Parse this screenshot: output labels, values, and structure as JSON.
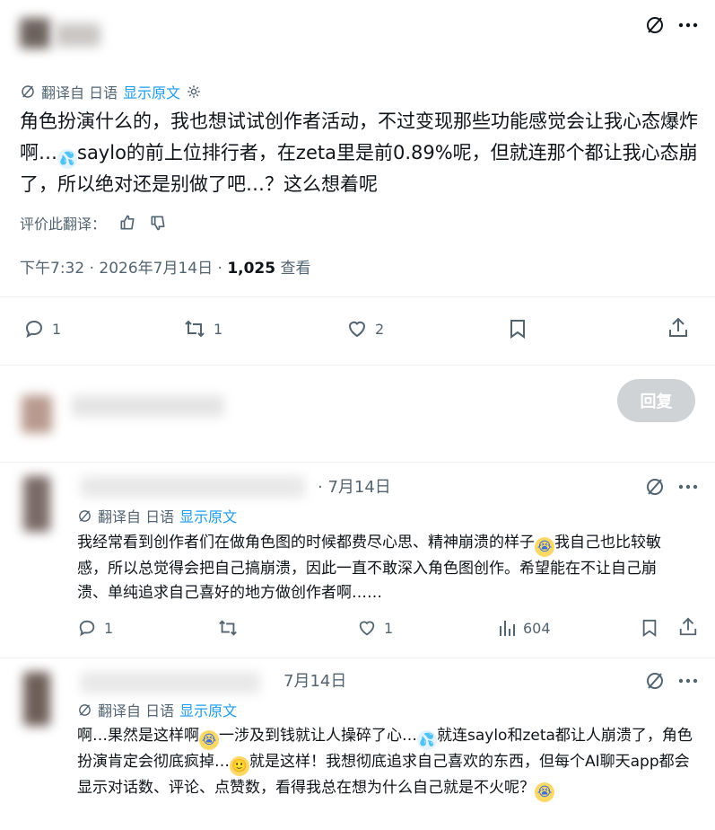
{
  "main_post": {
    "translate_label": "翻译自 日语",
    "show_original": "显示原文",
    "text": "角色扮演什么的，我也想试试创作者活动，不过变现那些功能感觉会让我心态爆炸啊…",
    "text_2": "saylo的前上位排行者，在zeta里是前0.89%呢，但就连那个都让我心态崩了，所以绝对还是别做了吧…？这么想着呢",
    "rate_label": "评价此翻译：",
    "time": "下午7:32 · 2026年7月14日 · ",
    "views_count": "1,025",
    "views_label": " 查看",
    "replies": "1",
    "reposts": "1",
    "likes": "2"
  },
  "reply_box": {
    "button_label": "回复"
  },
  "replies": [
    {
      "date": "· 7月14日",
      "translate_label": "翻译自 日语",
      "show_original": "显示原文",
      "text_a": "我经常看到创作者们在做角色图的时候都费尽心思、精神崩溃的样子",
      "text_b": "我自己也比较敏感，所以总觉得会把自己搞崩溃，因此一直不敢深入角色图创作。希望能在不让自己崩溃、单纯追求自己喜好的地方做创作者啊……",
      "replies": "1",
      "reposts": "",
      "likes": "1",
      "views": "604"
    },
    {
      "date": "7月14日",
      "translate_label": "翻译自 日语",
      "show_original": "显示原文",
      "text_a": "啊…果然是这样啊",
      "text_b": "一涉及到钱就让人操碎了心…",
      "text_c": "就连saylo和zeta都让人崩溃了，角色扮演肯定会彻底疯掉…",
      "text_d": "就是这样！我想彻底追求自己喜欢的东西，但每个AI聊天app都会显示对话数、评论、点赞数，看得我总在想为什么自己就是不火呢？"
    }
  ],
  "icons": {
    "translate": "translate-icon",
    "more": "more-icon",
    "settings": "gear-icon",
    "thumb_up": "thumbs-up-icon",
    "thumb_down": "thumbs-down-icon",
    "reply": "reply-icon",
    "repost": "repost-icon",
    "like": "heart-icon",
    "bookmark": "bookmark-icon",
    "share": "share-icon",
    "views": "views-icon"
  },
  "colors": {
    "accent": "#1d9bf0",
    "text": "#0f1419",
    "secondary": "#536471",
    "reply_button_bg": "#cfd3d6"
  }
}
